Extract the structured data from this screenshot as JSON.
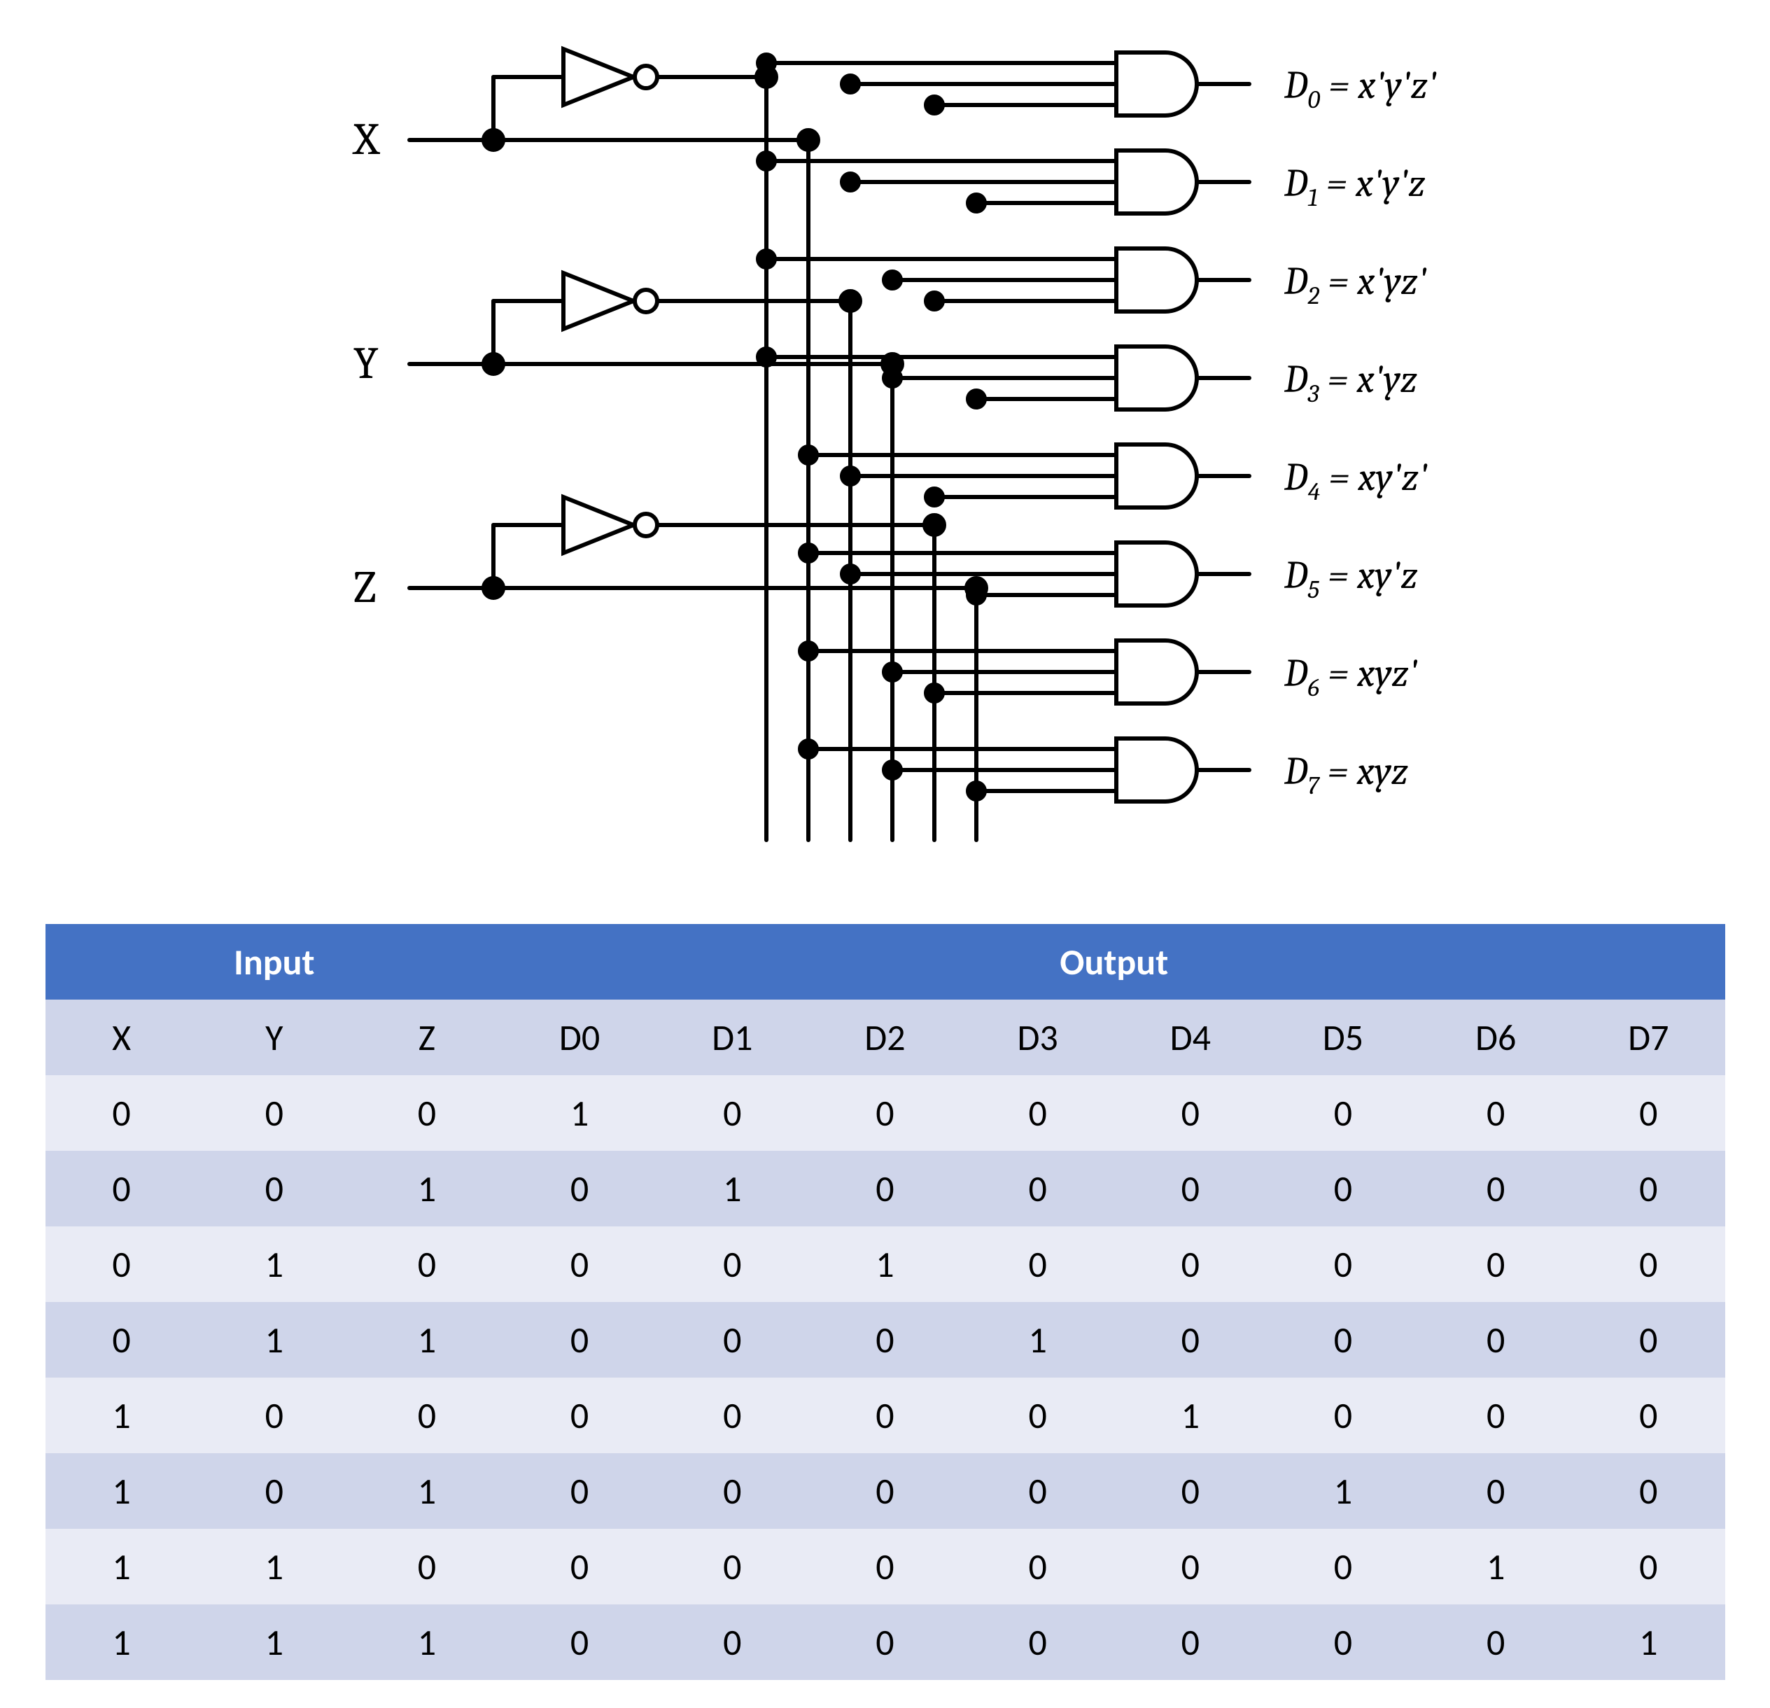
{
  "circuit": {
    "inputs": [
      "X",
      "Y",
      "Z"
    ],
    "gates": [
      "D0",
      "D1",
      "D2",
      "D3",
      "D4",
      "D5",
      "D6",
      "D7"
    ],
    "equations": {
      "D0": "x'y'z'",
      "D1": "x'y'z",
      "D2": "x'yz'",
      "D3": "x'yz",
      "D4": "xy'z'",
      "D5": "xy'z",
      "D6": "xyz'",
      "D7": "xyz"
    }
  },
  "table": {
    "group_headers": {
      "input": "Input",
      "output": "Output"
    },
    "columns_input": [
      "X",
      "Y",
      "Z"
    ],
    "columns_output": [
      "D0",
      "D1",
      "D2",
      "D3",
      "D4",
      "D5",
      "D6",
      "D7"
    ],
    "rows": [
      {
        "X": 0,
        "Y": 0,
        "Z": 0,
        "D0": 1,
        "D1": 0,
        "D2": 0,
        "D3": 0,
        "D4": 0,
        "D5": 0,
        "D6": 0,
        "D7": 0
      },
      {
        "X": 0,
        "Y": 0,
        "Z": 1,
        "D0": 0,
        "D1": 1,
        "D2": 0,
        "D3": 0,
        "D4": 0,
        "D5": 0,
        "D6": 0,
        "D7": 0
      },
      {
        "X": 0,
        "Y": 1,
        "Z": 0,
        "D0": 0,
        "D1": 0,
        "D2": 1,
        "D3": 0,
        "D4": 0,
        "D5": 0,
        "D6": 0,
        "D7": 0
      },
      {
        "X": 0,
        "Y": 1,
        "Z": 1,
        "D0": 0,
        "D1": 0,
        "D2": 0,
        "D3": 1,
        "D4": 0,
        "D5": 0,
        "D6": 0,
        "D7": 0
      },
      {
        "X": 1,
        "Y": 0,
        "Z": 0,
        "D0": 0,
        "D1": 0,
        "D2": 0,
        "D3": 0,
        "D4": 1,
        "D5": 0,
        "D6": 0,
        "D7": 0
      },
      {
        "X": 1,
        "Y": 0,
        "Z": 1,
        "D0": 0,
        "D1": 0,
        "D2": 0,
        "D3": 0,
        "D4": 0,
        "D5": 1,
        "D6": 0,
        "D7": 0
      },
      {
        "X": 1,
        "Y": 1,
        "Z": 0,
        "D0": 0,
        "D1": 0,
        "D2": 0,
        "D3": 0,
        "D4": 0,
        "D5": 0,
        "D6": 1,
        "D7": 0
      },
      {
        "X": 1,
        "Y": 1,
        "Z": 1,
        "D0": 0,
        "D1": 0,
        "D2": 0,
        "D3": 0,
        "D4": 0,
        "D5": 0,
        "D6": 0,
        "D7": 1
      }
    ]
  }
}
